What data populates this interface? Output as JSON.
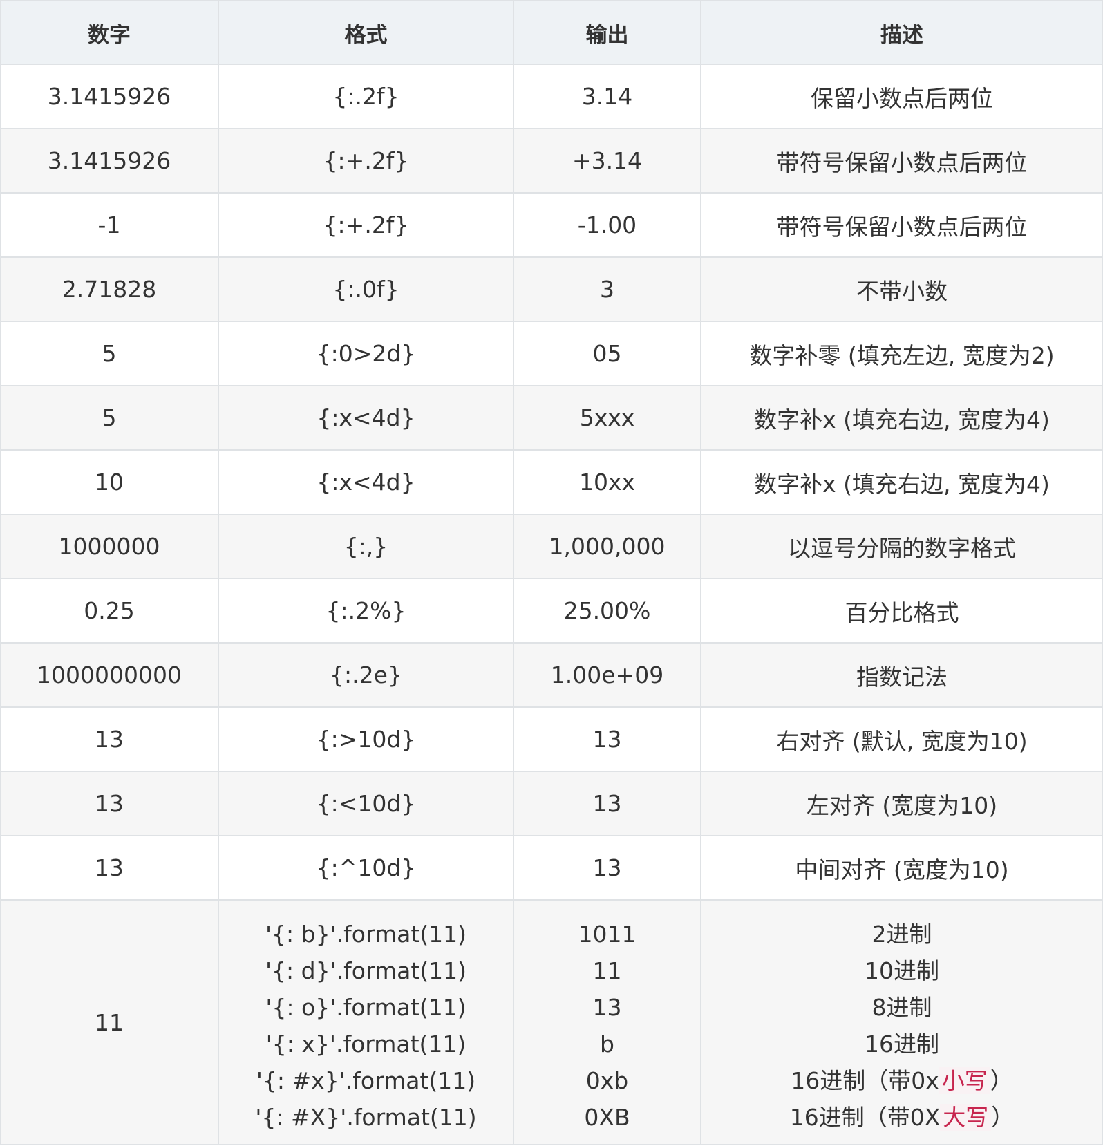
{
  "table": {
    "headers": [
      "数字",
      "格式",
      "输出",
      "描述"
    ],
    "rows": [
      [
        "3.1415926",
        "{:.2f}",
        "3.14",
        "保留小数点后两位"
      ],
      [
        "3.1415926",
        "{:+.2f}",
        "+3.14",
        "带符号保留小数点后两位"
      ],
      [
        "-1",
        "{:+.2f}",
        "-1.00",
        "带符号保留小数点后两位"
      ],
      [
        "2.71828",
        "{:.0f}",
        "3",
        "不带小数"
      ],
      [
        "5",
        "{:0>2d}",
        "05",
        "数字补零 (填充左边, 宽度为2)"
      ],
      [
        "5",
        "{:x<4d}",
        "5xxx",
        "数字补x (填充右边, 宽度为4)"
      ],
      [
        "10",
        "{:x<4d}",
        "10xx",
        "数字补x (填充右边, 宽度为4)"
      ],
      [
        "1000000",
        "{:,}",
        "1,000,000",
        "以逗号分隔的数字格式"
      ],
      [
        "0.25",
        "{:.2%}",
        "25.00%",
        "百分比格式"
      ],
      [
        "1000000000",
        "{:.2e}",
        "1.00e+09",
        "指数记法"
      ],
      [
        "13",
        "{:>10d}",
        "13",
        "右对齐 (默认, 宽度为10)"
      ],
      [
        "13",
        "{:<10d}",
        "13",
        "左对齐 (宽度为10)"
      ],
      [
        "13",
        "{:^10d}",
        "13",
        "中间对齐 (宽度为10)"
      ]
    ],
    "multi_row": {
      "number": "11",
      "formats": [
        "'{: b}'.format(11)",
        "'{: d}'.format(11)",
        "'{: o}'.format(11)",
        "'{: x}'.format(11)",
        "'{: #x}'.format(11)",
        "'{: #X}'.format(11)"
      ],
      "outputs": [
        "1011",
        "11",
        "13",
        "b",
        "0xb",
        "0XB"
      ],
      "descriptions": [
        {
          "pre": "2进制",
          "hl": "",
          "post": ""
        },
        {
          "pre": "10进制",
          "hl": "",
          "post": ""
        },
        {
          "pre": "8进制",
          "hl": "",
          "post": ""
        },
        {
          "pre": "16进制",
          "hl": "",
          "post": ""
        },
        {
          "pre": "16进制（带0x",
          "hl": "小写",
          "post": "）"
        },
        {
          "pre": "16进制（带0X",
          "hl": "大写",
          "post": "）"
        }
      ]
    },
    "highlight_color": "#c7254e"
  }
}
